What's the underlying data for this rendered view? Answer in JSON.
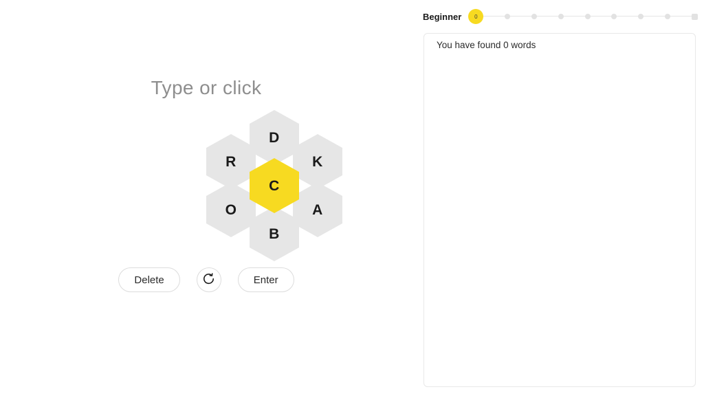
{
  "entry": {
    "placeholder": "Type or click",
    "value": ""
  },
  "hive": {
    "center": {
      "letter": "C",
      "color": "#f7da21"
    },
    "outer_color": "#e6e6e6",
    "outer": [
      {
        "letter": "D",
        "position": "top"
      },
      {
        "letter": "K",
        "position": "top-right"
      },
      {
        "letter": "A",
        "position": "bottom-right"
      },
      {
        "letter": "B",
        "position": "bottom"
      },
      {
        "letter": "O",
        "position": "bottom-left"
      },
      {
        "letter": "R",
        "position": "top-left"
      }
    ]
  },
  "controls": {
    "delete_label": "Delete",
    "shuffle_icon": "shuffle-icon",
    "enter_label": "Enter"
  },
  "rank": {
    "label": "Beginner",
    "current_score": "0",
    "milestones": [
      "",
      "",
      "",
      "",
      "",
      "",
      ""
    ],
    "accent_color": "#f7da21",
    "dot_color": "#e2e2e2"
  },
  "words": {
    "count_text": "You have found 0 words",
    "items": []
  }
}
